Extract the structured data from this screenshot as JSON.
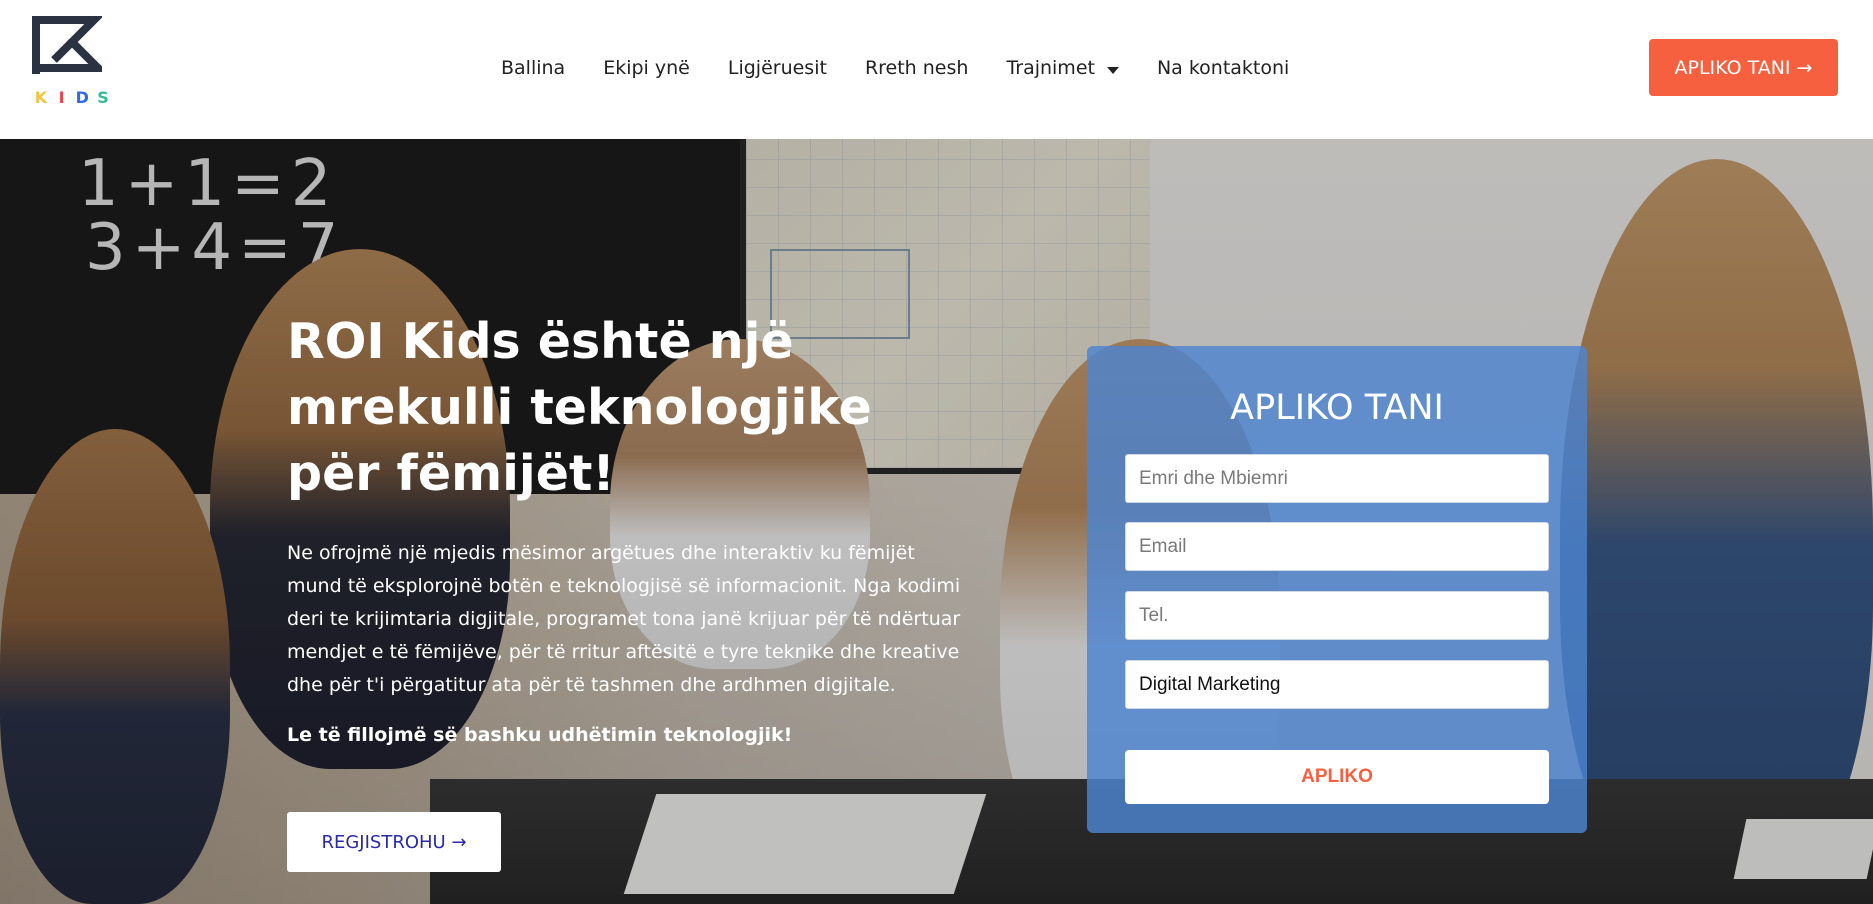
{
  "brand": {
    "logo_alt": "ROI Kids",
    "logo_letters": [
      "K",
      "I",
      "D",
      "S"
    ],
    "logo_letter_colors": [
      "#f4c542",
      "#e7454a",
      "#2e6be6",
      "#35b999"
    ],
    "logo_mark_color": "#2b3242"
  },
  "nav": {
    "items": [
      {
        "label": "Ballina"
      },
      {
        "label": "Ekipi ynë"
      },
      {
        "label": "Ligjëruesit"
      },
      {
        "label": "Rreth nesh"
      },
      {
        "label": "Trajnimet",
        "has_dropdown": true
      },
      {
        "label": "Na kontaktoni"
      }
    ],
    "apply_label": "APLIKO TANI →"
  },
  "hero": {
    "chalk_line_1": "1+1=2",
    "chalk_line_2": "3+4=7",
    "title": "ROI Kids është një mrekulli teknologjike për fëmijët!",
    "description": "Ne ofrojmë një mjedis mësimor argëtues dhe interaktiv ku fëmijët mund të eksplorojnë botën e teknologjisë së informacionit. Nga kodimi deri te krijimtaria digjitale, programet tona janë krijuar për të ndërtuar mendjet e të fëmijëve, për të rritur aftësitë e tyre teknike dhe kreative dhe për t'i përgatitur ata për të tashmen dhe ardhmen digjitale.",
    "cta_text": "Le të fillojmë së bashku udhëtimin teknologjik!",
    "register_label": "REGJISTROHU →"
  },
  "form": {
    "title": "APLIKO TANI",
    "name_placeholder": "Emri dhe Mbiemri",
    "email_placeholder": "Email",
    "phone_placeholder": "Tel.",
    "course_selected": "Digital Marketing",
    "submit_label": "APLIKO"
  },
  "colors": {
    "accent": "#f7603f",
    "form_bg": "#4d84d0",
    "register_text": "#2a2aa8"
  }
}
